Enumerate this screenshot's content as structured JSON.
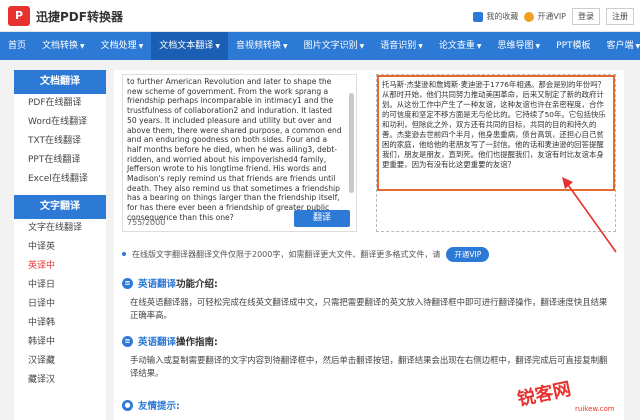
{
  "header": {
    "logo_mark": "P",
    "app_title": "迅捷PDF转换器",
    "favorites": "我的收藏",
    "vip": "开通VIP",
    "login": "登录",
    "register": "注册"
  },
  "nav": [
    {
      "label": "首页",
      "caret": false
    },
    {
      "label": "文档转换",
      "caret": true
    },
    {
      "label": "文档处理",
      "caret": true
    },
    {
      "label": "文档文本翻译",
      "caret": true
    },
    {
      "label": "音视频转换",
      "caret": true
    },
    {
      "label": "图片文字识别",
      "caret": true
    },
    {
      "label": "语音识别",
      "caret": true
    },
    {
      "label": "论文查重",
      "caret": true
    },
    {
      "label": "思维导图",
      "caret": true
    },
    {
      "label": "PPT模板",
      "caret": false
    },
    {
      "label": "客户端",
      "caret": true
    }
  ],
  "sidebar": {
    "doc_header": "文档翻译",
    "doc_items": [
      "PDF在线翻译",
      "Word在线翻译",
      "TXT在线翻译",
      "PPT在线翻译",
      "Excel在线翻译"
    ],
    "text_header": "文字翻译",
    "text_items": [
      "文字在线翻译",
      "中译英",
      "英译中",
      "中译日",
      "日译中",
      "中译韩",
      "韩译中",
      "汉译藏",
      "藏译汉"
    ]
  },
  "source": {
    "text": "to further American Revolution and later to shape the new scheme of government. From the work sprang a friendship perhaps incomparable in intimacy1 and the trustfulness of collaboration2 and induration. It lasted 50 years. It included pleasure and utility but over and above them, there were shared purpose, a common end and an enduring goodness on both sides. Four and a half months before he died, when he was ailing3, debt-ridden, and worried about his impoverished4 family, Jefferson wrote to his longtime friend. His words and Madison's reply remind us that friends are friends until death. They also remind us that sometimes a friendship has a bearing on things larger than the friendship itself, for has there ever been a friendship of greater public consequence than this one?",
    "char_count": "755/2000",
    "translate_label": "翻译"
  },
  "output": {
    "text": "托马斯·杰斐逊和詹姆斯·麦迪逊于1776年相遇。那会是别的年份吗？从那时开始，他们共同努力推动美国革命，后来又制定了新的政府计划。从这份工作中产生了一种友谊，这种友谊也许在亲密程度，合作的可信度和坚定不移方面是无与伦比的。它持续了50年。它包括快乐和功利，但除此之外，双方还有共同的目标，共同的目的和持久的善。杰斐逊去世前四个半月，他身患重病，债台高筑，还担心自己贫困的家庭，他给他的老朋友写了一封信。他的话和麦迪逊的回答提醒我们，朋友是朋友，直到死。他们也提醒我们，友谊有时比友谊本身更重要，因为有没有比这更重要的友谊？"
  },
  "notice": {
    "text": "在线版文字翻译器翻译文件仅限于2000字，如需翻译更大文件、翻译更多格式文件，请",
    "vip_label": "开通VIP"
  },
  "sections": {
    "intro_title_blue": "英语翻译",
    "intro_title_rest": " 功能介绍:",
    "intro_text": "在线英语翻译器，可轻松完成在线英文翻译成中文，只需把需要翻译的英文放入待翻译框中即可进行翻译操作，翻译速度快且结果正确率高。",
    "guide_title_blue": "英语翻译",
    "guide_title_rest": " 操作指南:",
    "guide_text": "手动输入或复制需要翻译的文字内容到待翻译框中，然后单击翻译按钮，翻译结果会出现在右侧边框中，翻译完成后可直接复制翻译结果。",
    "tips_title": "友情提示:"
  },
  "watermark": {
    "main": "锐客网",
    "sub": "ruikew.com"
  }
}
